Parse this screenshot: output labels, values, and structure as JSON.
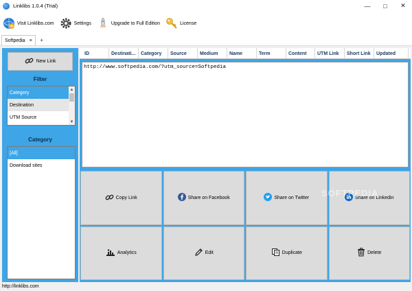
{
  "window": {
    "title": "Linklibs 1.0.4 (Trial)"
  },
  "toolbar": {
    "visit_label": "Visit Linklibs.com",
    "settings_label": "Settings",
    "upgrade_label": "Upgrade to Full Edition",
    "license_label": "License"
  },
  "tabs": {
    "active": "Softpedia",
    "add": "+"
  },
  "left": {
    "new_link_label": "New Link",
    "filter_heading": "Filter",
    "filter_items": [
      "Category",
      "Destination",
      "UTM Source"
    ],
    "category_heading": "Category",
    "category_items": [
      "[All]",
      "Download sites"
    ]
  },
  "grid": {
    "columns": [
      "ID",
      "Destinati...",
      "Category",
      "Source",
      "Medium",
      "Name",
      "Term",
      "Content",
      "UTM Link",
      "Short Link",
      "Updated"
    ]
  },
  "url_text": "http://www.softpedia.com/?utm_source=Softpedia",
  "actions": {
    "copy_link": "Copy Link",
    "share_facebook": "Share on Facebook",
    "share_twitter": "Share on Twitter",
    "share_linkedin": "Share on Linkedin",
    "analytics": "Analytics",
    "edit": "Edit",
    "duplicate": "Duplicate",
    "delete": "Delete"
  },
  "watermark": "SOFTPEDIA",
  "status": {
    "text": "http://linklibs.com"
  },
  "colors": {
    "accent": "#3ea5e6",
    "facebook": "#3b5998",
    "twitter": "#1da1f2",
    "linkedin": "#0a66c2"
  }
}
